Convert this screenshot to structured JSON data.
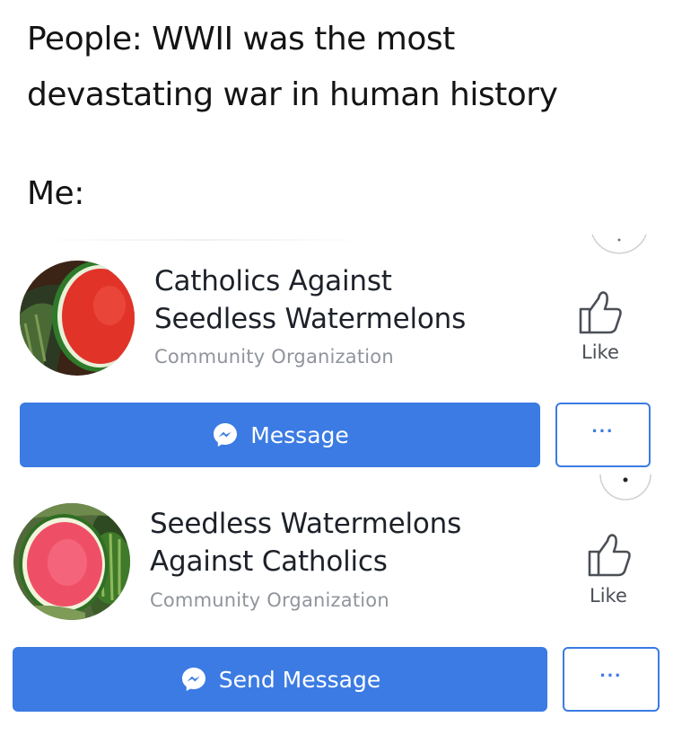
{
  "caption": {
    "line1": "People: WWII was the most",
    "line2": "devastating war in human history",
    "line3": "Me:"
  },
  "colors": {
    "button_blue": "#3b7be3",
    "text_dark": "#1d2129",
    "text_gray": "#90949c"
  },
  "pages": [
    {
      "name_line1": "Catholics Against",
      "name_line2": "Seedless Watermelons",
      "category": "Community Organization",
      "like_label": "Like",
      "like_icon": "thumbs-up-icon",
      "button_label": "Message",
      "button_icon": "messenger-icon",
      "more_label": "···",
      "avatar": "watermelon-slice-photo"
    },
    {
      "name_line1": "Seedless Watermelons",
      "name_line2": "Against Catholics",
      "category": "Community Organization",
      "like_label": "Like",
      "like_icon": "thumbs-up-icon",
      "button_label": "Send Message",
      "button_icon": "messenger-icon",
      "more_label": "···",
      "avatar": "seedless-watermelon-photo"
    }
  ]
}
